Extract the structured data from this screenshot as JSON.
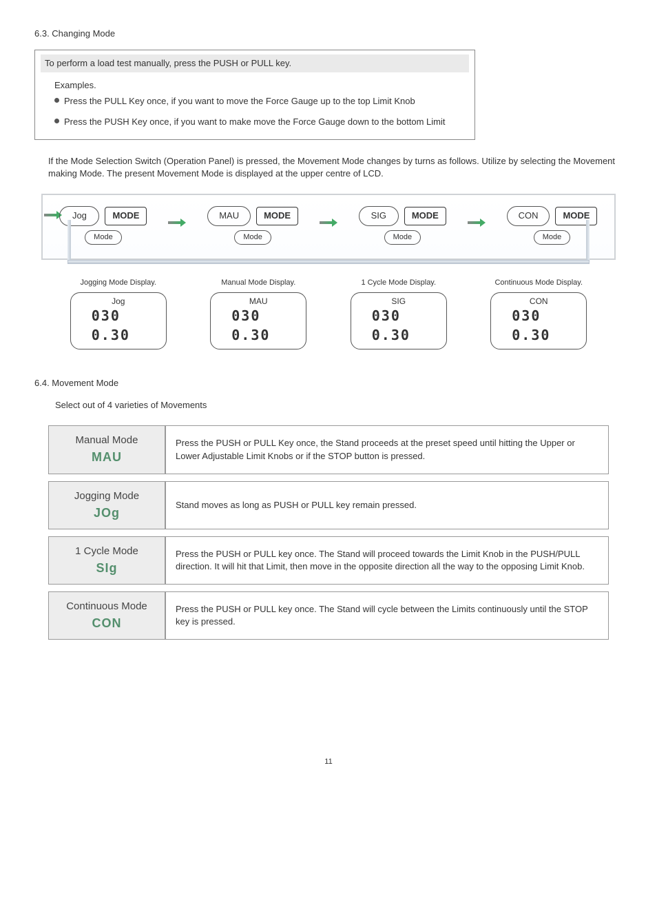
{
  "section63": {
    "heading": "6.3. Changing Mode",
    "callout_header": "To perform a load test manually, press the PUSH or PULL key.",
    "examples_label": "Examples.",
    "bullet1": "Press the PULL Key once, if you want to  move the Force Gauge up to the top Limit Knob",
    "bullet2": "Press the PUSH Key once, if you want to make move the Force Gauge down to the bottom Limit",
    "paragraph": "If the Mode Selection Switch (Operation Panel) is pressed, the Movement Mode changes by turns as follows. Utilize by selecting the Movement making Mode. The present Movement Mode is displayed at the upper centre of LCD.",
    "modes": [
      {
        "pill": "Jog",
        "sub": "Mode",
        "key": "MODE"
      },
      {
        "pill": "MAU",
        "sub": "Mode",
        "key": "MODE"
      },
      {
        "pill": "SIG",
        "sub": "Mode",
        "key": "MODE"
      },
      {
        "pill": "CON",
        "sub": "Mode",
        "key": "MODE"
      }
    ],
    "lcd": [
      {
        "caption": "Jogging Mode Display.",
        "label": "Jog",
        "seg": "030\n0.30"
      },
      {
        "caption": "Manual Mode Display.",
        "label": "MAU",
        "seg": "030\n0.30"
      },
      {
        "caption": "1 Cycle Mode Display.",
        "label": "SIG",
        "seg": "030\n0.30"
      },
      {
        "caption": "Continuous Mode Display.",
        "label": "CON",
        "seg": "030\n0.30"
      }
    ]
  },
  "section64": {
    "heading": "6.4. Movement Mode",
    "intro": "Select out of 4 varieties of Movements",
    "rows": [
      {
        "title": "Manual  Mode",
        "code": "MAU",
        "desc": "Press the PUSH or PULL Key once, the Stand proceeds at the preset speed until hitting the Upper or Lower Adjustable Limit Knobs or if the STOP button is pressed."
      },
      {
        "title": "Jogging  Mode",
        "code": "JOg",
        "desc": "Stand moves as long as PUSH or PULL key remain pressed."
      },
      {
        "title": "1 Cycle  Mode",
        "code": "SIg",
        "desc": "Press the PUSH or PULL key once.  The Stand will proceed towards the Limit Knob in the PUSH/PULL direction.  It will hit that Limit, then move in the opposite direction all the way to the opposing Limit Knob."
      },
      {
        "title": "Continuous Mode",
        "code": "CON",
        "desc": "Press the PUSH or PULL key once.  The Stand will cycle between the Limits continuously until the STOP key is pressed."
      }
    ]
  },
  "page_number": "11"
}
